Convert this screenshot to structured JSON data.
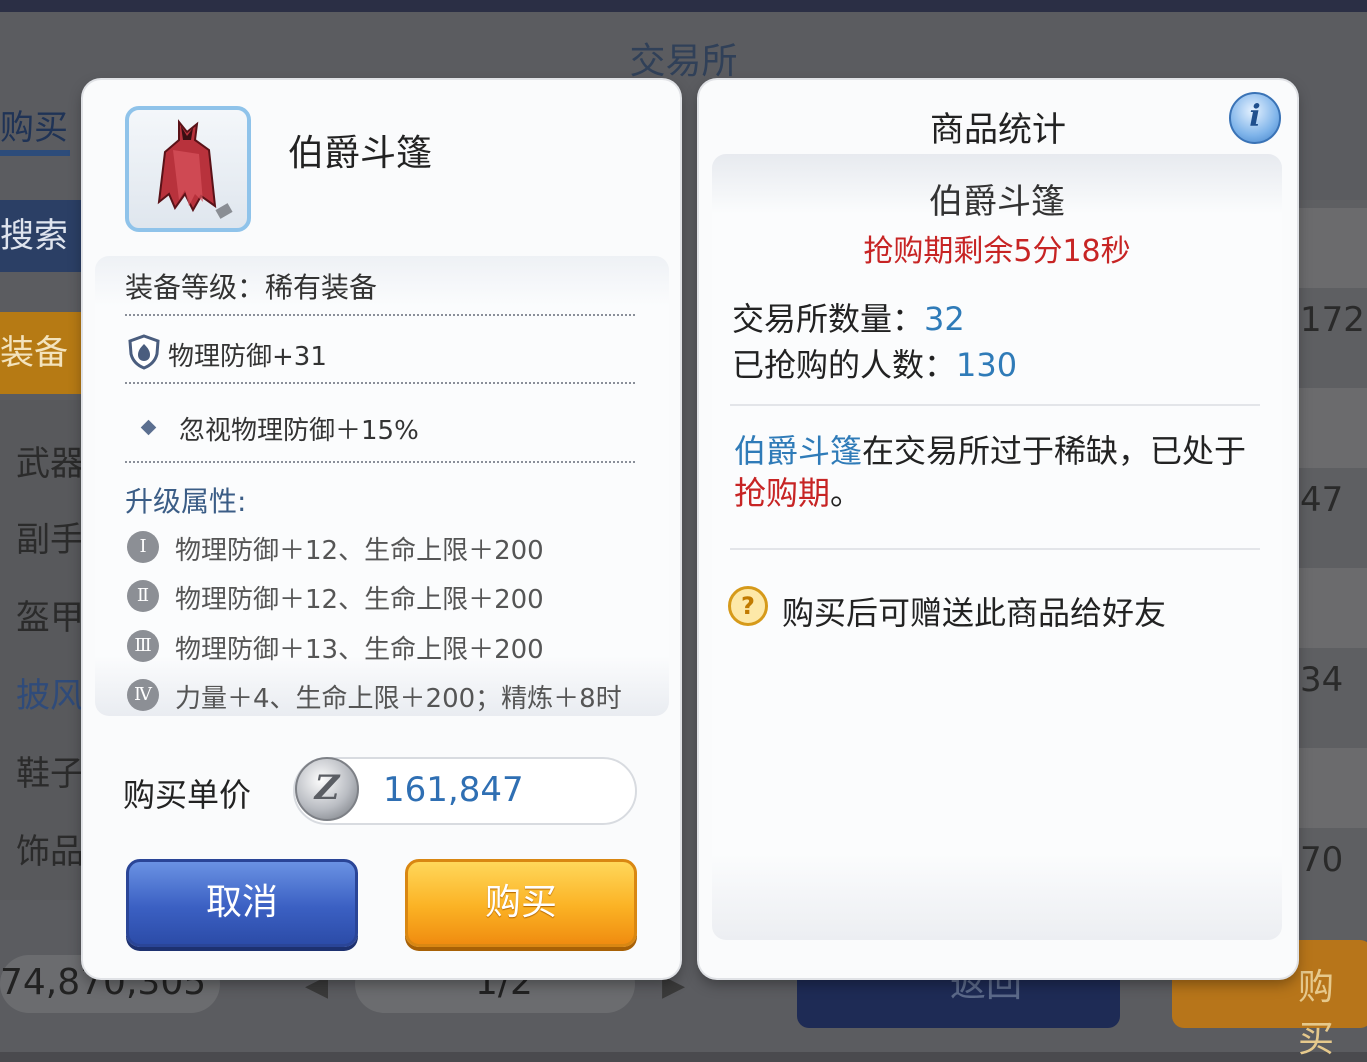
{
  "background": {
    "title": "交易所",
    "tab_buy": "购买",
    "search": "搜索",
    "equip_tab": "装备",
    "categories": [
      "武器",
      "副手",
      "盔甲",
      "披风",
      "鞋子",
      "饰品"
    ],
    "right_numbers": [
      "172",
      "47",
      "34",
      "70"
    ],
    "bottom_total": "74,870,305",
    "page_indicator": "1/2",
    "back_button": "返回",
    "buy_button": "购买"
  },
  "item_panel": {
    "name": "伯爵斗篷",
    "grade": "装备等级：稀有装备",
    "physical_defense": "物理防御+31",
    "ignore_defense": "忽视物理防御＋15%",
    "upgrade_title": "升级属性:",
    "upgrades": [
      {
        "level": "Ⅰ",
        "text": "物理防御＋12、生命上限＋200"
      },
      {
        "level": "Ⅱ",
        "text": "物理防御＋12、生命上限＋200"
      },
      {
        "level": "Ⅲ",
        "text": "物理防御＋13、生命上限＋200"
      },
      {
        "level": "Ⅳ",
        "text": "力量＋4、生命上限＋200；精炼＋8时"
      }
    ],
    "price_label": "购买单价",
    "price_value": "161,847",
    "cancel_label": "取消",
    "buy_label": "购买"
  },
  "stats_panel": {
    "title": "商品统计",
    "item_name": "伯爵斗篷",
    "timer": "抢购期剩余5分18秒",
    "exchange_qty_label": "交易所数量：",
    "exchange_qty_value": "32",
    "buyers_label": "已抢购的人数：",
    "buyers_value": "130",
    "scarce_item": "伯爵斗篷",
    "scarce_text": "在交易所过于稀缺，已处于",
    "scarce_period": "抢购期",
    "scarce_end": "。",
    "gift_note": "购买后可赠送此商品给好友"
  },
  "colors": {
    "accent_blue": "#2f7bb8",
    "alert_red": "#c72424",
    "cancel_button": "#3b60c3",
    "buy_button": "#fbb224"
  }
}
